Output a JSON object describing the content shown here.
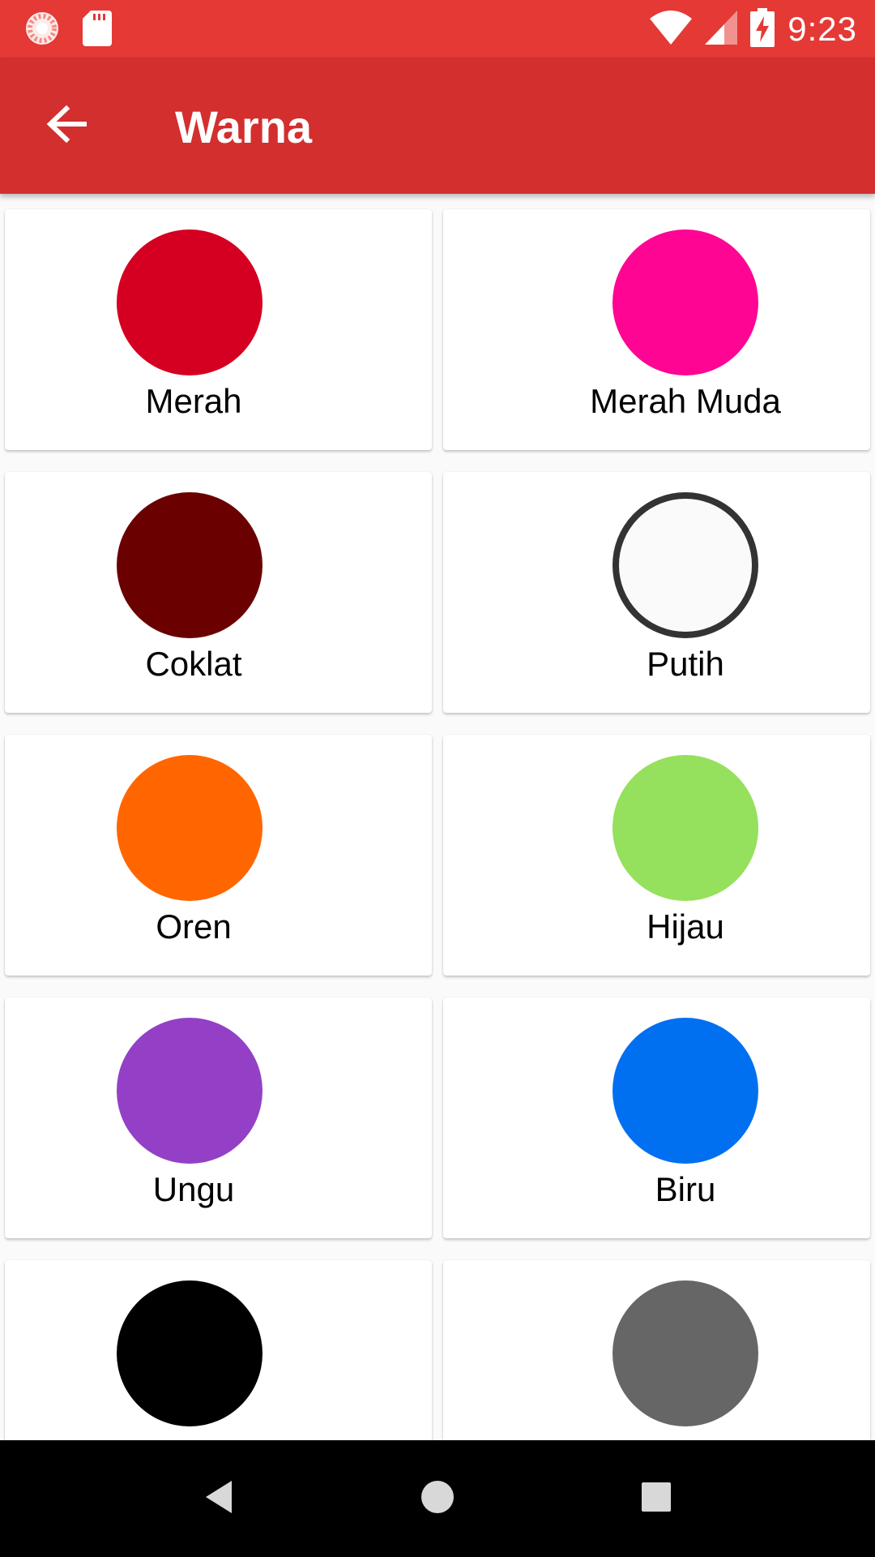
{
  "status_bar": {
    "time": "9:23",
    "icons": [
      "loading-spinner-icon",
      "sd-card-icon",
      "wifi-icon",
      "signal-icon",
      "battery-charging-icon"
    ],
    "background": "#e53935"
  },
  "app_bar": {
    "title": "Warna",
    "back_icon": "arrow-back-icon",
    "background": "#d32f2f"
  },
  "colors": [
    {
      "label": "Merah",
      "hex": "#d50021"
    },
    {
      "label": "Merah Muda",
      "hex": "#ff0593"
    },
    {
      "label": "Coklat",
      "hex": "#6b0000"
    },
    {
      "label": "Putih",
      "hex": "#fafafa",
      "outline": "#333333"
    },
    {
      "label": "Oren",
      "hex": "#ff6600"
    },
    {
      "label": "Hijau",
      "hex": "#95e05c"
    },
    {
      "label": "Ungu",
      "hex": "#9340c6"
    },
    {
      "label": "Biru",
      "hex": "#0070f0"
    },
    {
      "label": "",
      "hex": "#000000"
    },
    {
      "label": "",
      "hex": "#666666"
    }
  ],
  "nav_bar": {
    "buttons": [
      "back-triangle-icon",
      "home-circle-icon",
      "recents-square-icon"
    ]
  }
}
